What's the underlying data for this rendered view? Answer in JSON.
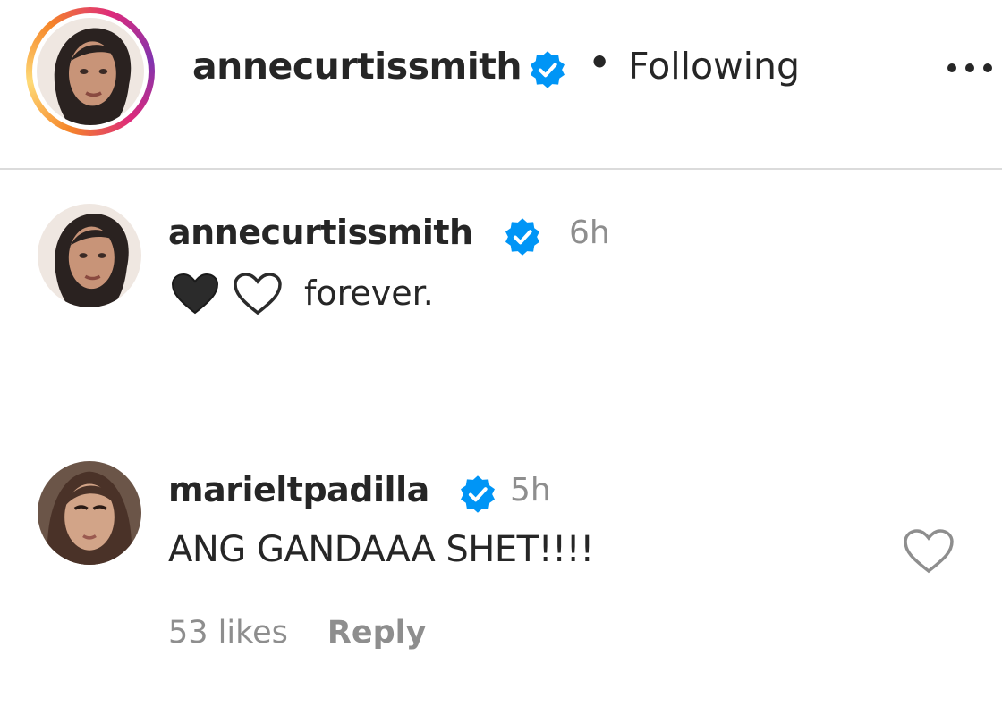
{
  "colors": {
    "text": "#262626",
    "muted": "#8e8e8e",
    "verified_blue": "#0095f6",
    "divider": "#dbdbdb"
  },
  "header": {
    "username": "annecurtissmith",
    "separator": "•",
    "follow_status": "Following",
    "more_icon": "more-horizontal-icon",
    "verified_icon": "verified-badge-icon"
  },
  "comments": [
    {
      "username": "annecurtissmith",
      "verified": true,
      "time": "6h",
      "emojis": [
        "black-heart",
        "white-heart"
      ],
      "text": "forever."
    },
    {
      "username": "marieltpadilla",
      "verified": true,
      "time": "5h",
      "text": "ANG GANDAAA SHET!!!!",
      "likes": "53 likes",
      "reply_label": "Reply",
      "like_icon": "heart-outline-icon"
    }
  ]
}
